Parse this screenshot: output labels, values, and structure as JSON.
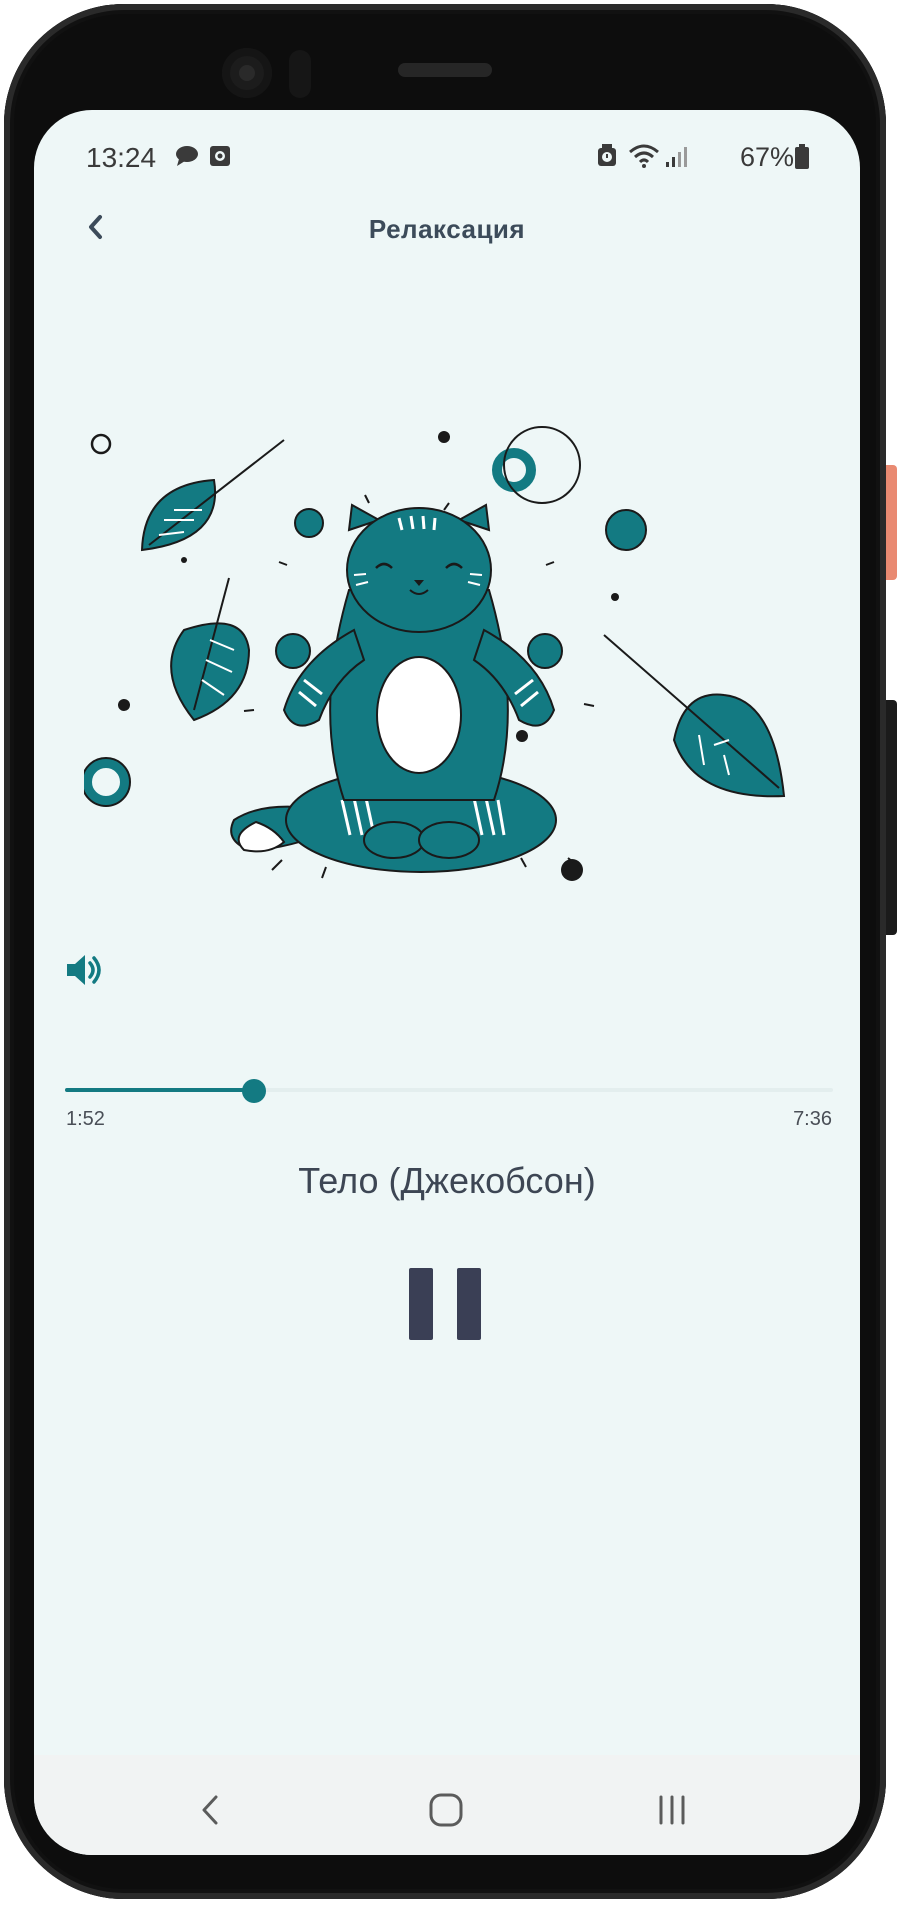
{
  "status_bar": {
    "time": "13:24",
    "battery_percent": "67%",
    "icons": [
      "chat-bubble-icon",
      "screenshot-icon",
      "alarm-icon",
      "wifi-icon",
      "signal-icon",
      "battery-icon"
    ]
  },
  "header": {
    "title": "Релаксация",
    "back_icon": "chevron-left-icon"
  },
  "player": {
    "elapsed": "1:52",
    "total": "7:36",
    "progress_fraction": 0.246,
    "track_title": "Тело (Джекобсон)",
    "volume_icon": "speaker-icon",
    "play_state_icon": "pause-icon"
  },
  "navbar": {
    "icons": [
      "nav-back-icon",
      "nav-home-icon",
      "nav-recents-icon"
    ]
  },
  "colors": {
    "accent": "#137a82",
    "background": "#eef7f7",
    "title_text": "#3c4b5a",
    "pause_button": "#3a3f55"
  }
}
